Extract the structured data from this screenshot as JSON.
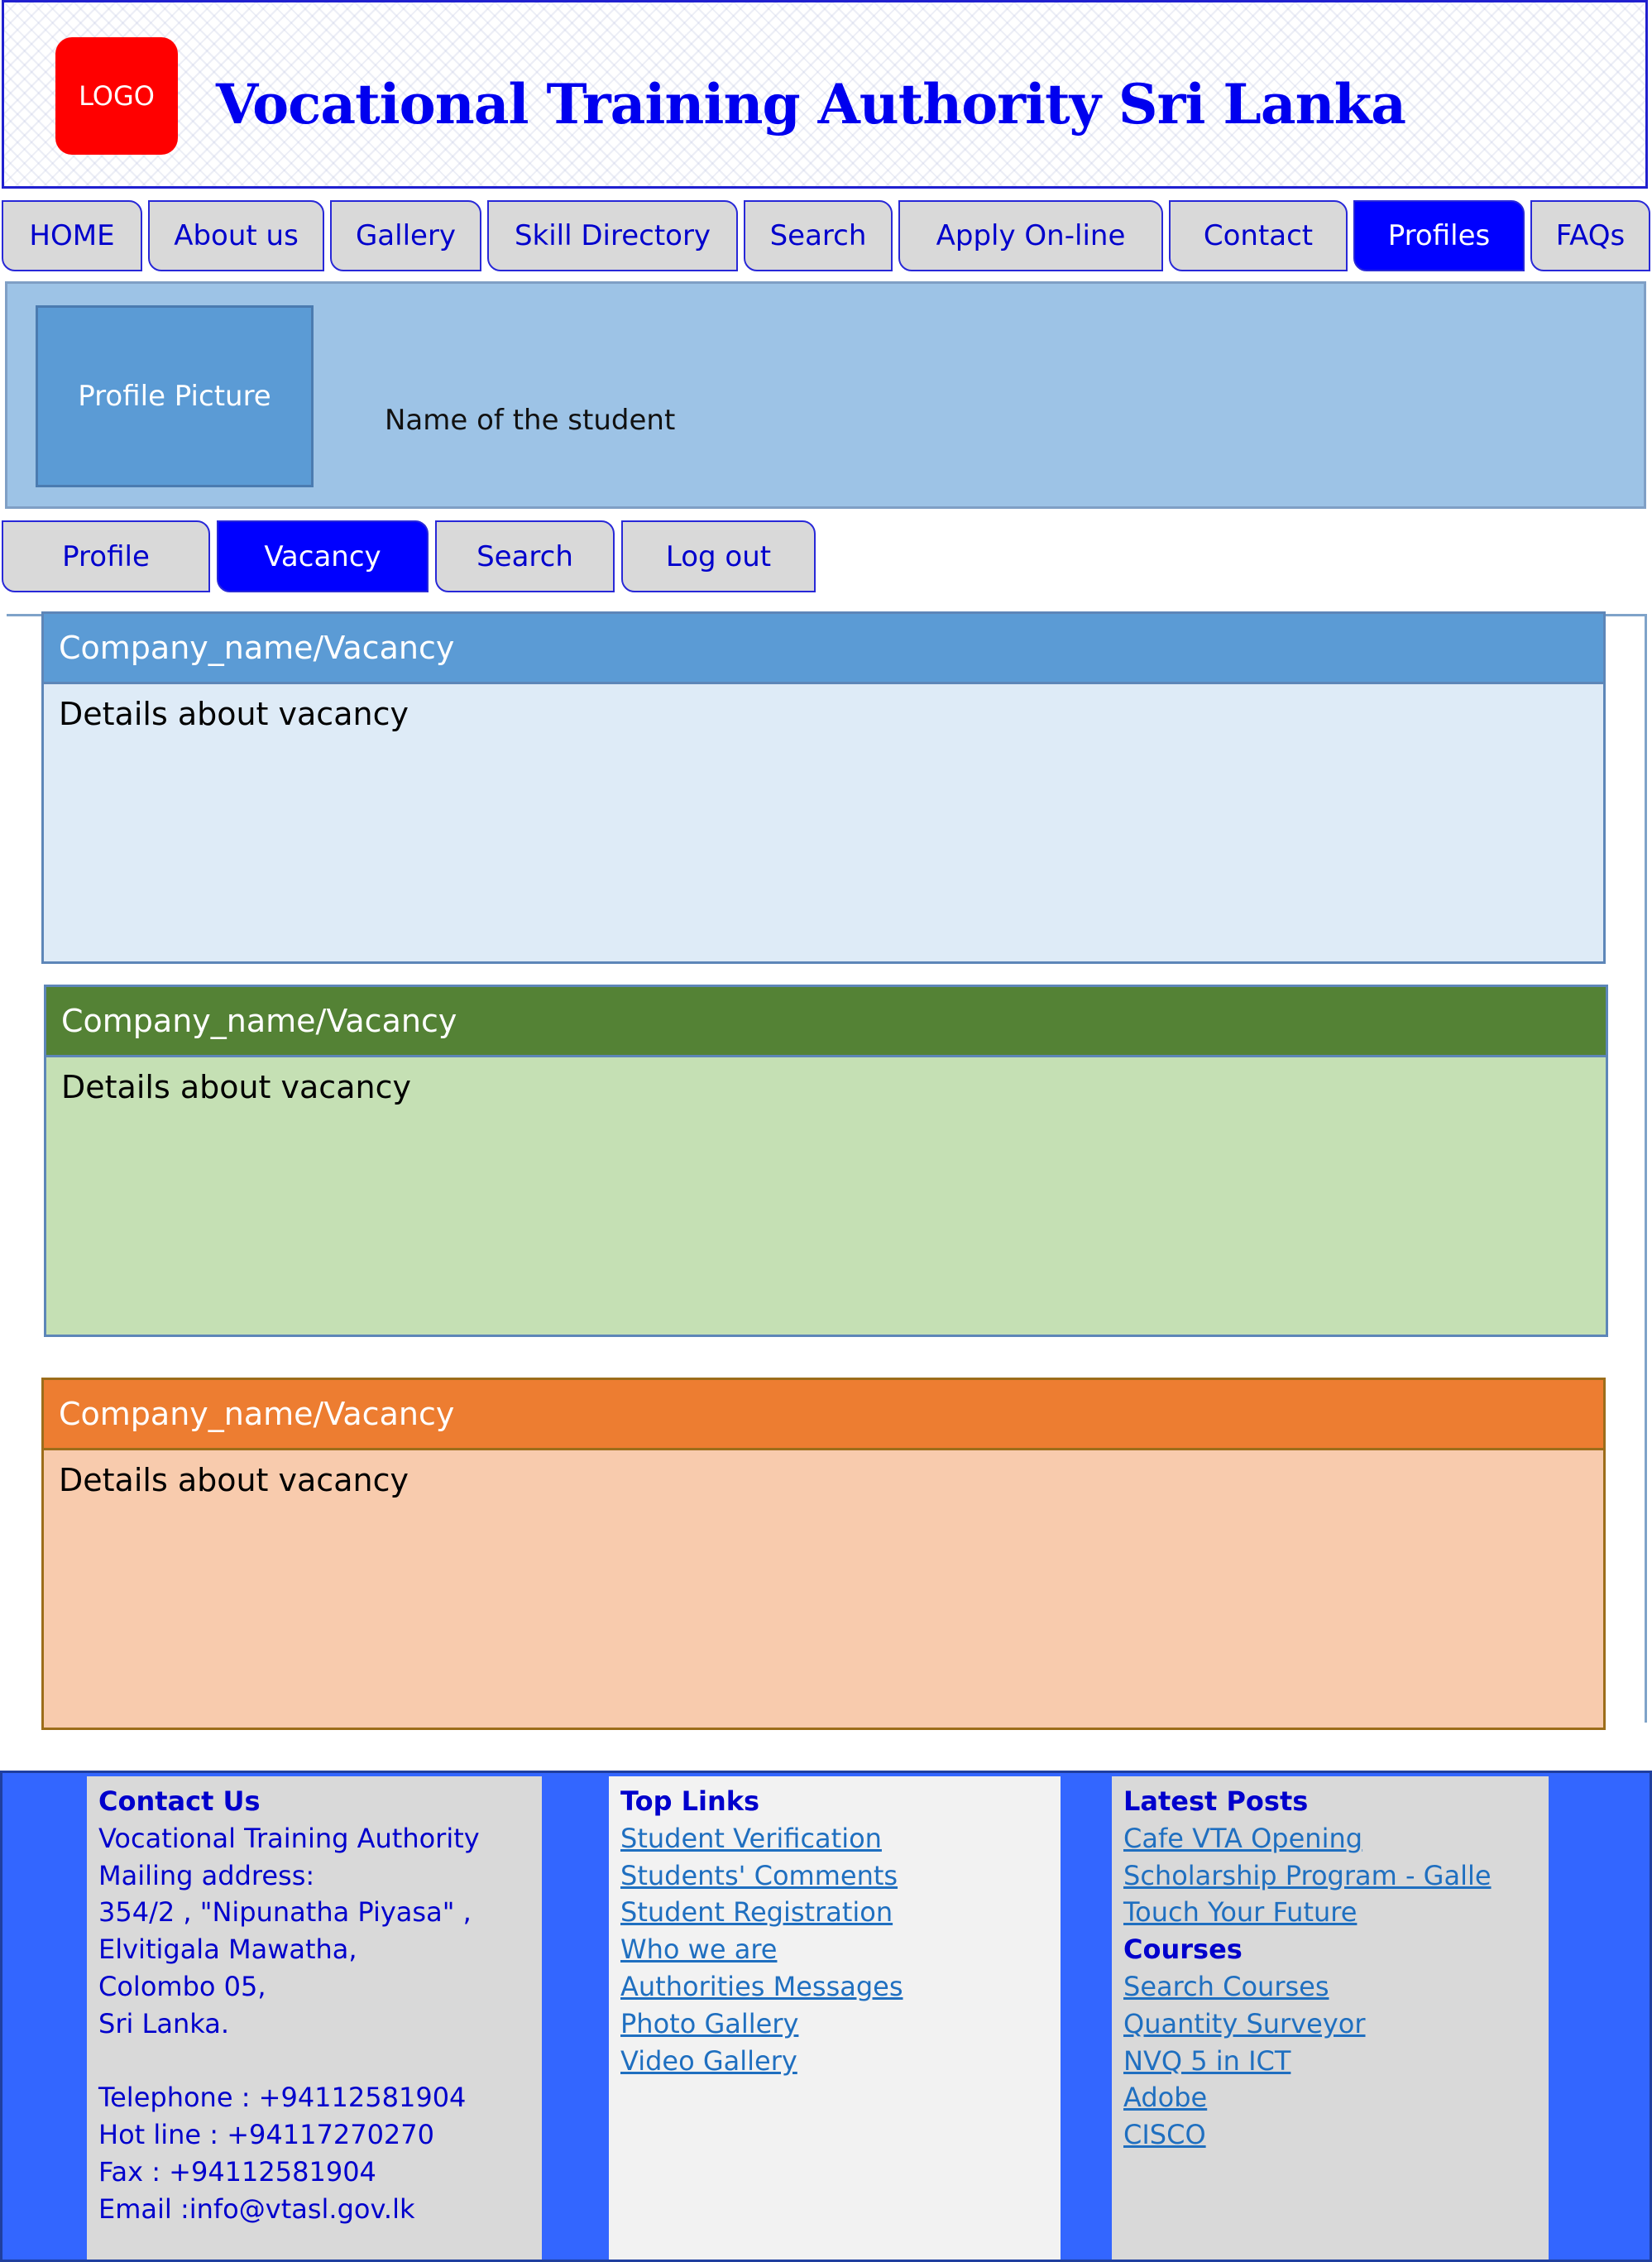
{
  "header": {
    "logo_text": "LOGO",
    "title": "Vocational Training Authority Sri Lanka"
  },
  "nav": {
    "tabs": [
      "HOME",
      "About us",
      "Gallery",
      "Skill Directory",
      "Search",
      "Apply On-line",
      "Contact",
      "Profiles",
      "FAQs"
    ],
    "active": "Profiles"
  },
  "profile": {
    "picture_label": "Profile Picture",
    "student_name": "Name of the student"
  },
  "subnav": {
    "tabs": [
      "Profile",
      "Vacancy",
      "Search",
      "Log out"
    ],
    "active": "Vacancy"
  },
  "vacancies": [
    {
      "title": "Company_name/Vacancy",
      "details": "Details about vacancy",
      "header_color": "#5b9bd5",
      "body_color": "#deebf7",
      "border_color": "#5d86b8"
    },
    {
      "title": "Company_name/Vacancy",
      "details": "Details about vacancy",
      "header_color": "#548235",
      "body_color": "#c5e0b4",
      "border_color": "#5d86b8"
    },
    {
      "title": "Company_name/Vacancy",
      "details": "Details about vacancy",
      "header_color": "#ed7d31",
      "body_color": "#f8cbad",
      "border_color": "#9c6d1a"
    }
  ],
  "footer": {
    "contact": {
      "heading": "Contact Us",
      "lines": [
        "Vocational Training Authority",
        "Mailing address:",
        "354/2 , \"Nipunatha Piyasa\" ,",
        "Elvitigala Mawatha,",
        "Colombo 05,",
        "Sri Lanka."
      ],
      "phones": [
        "Telephone : +94112581904",
        "Hot line : +94117270270",
        "Fax : +94112581904",
        "Email :info@vtasl.gov.lk"
      ]
    },
    "top_links": {
      "heading": "Top Links",
      "links": [
        "Student Verification",
        "Students' Comments",
        "Student Registration",
        "Who we are",
        "Authorities Messages",
        "Photo Gallery",
        "Video Gallery"
      ]
    },
    "latest_posts": {
      "heading": "Latest Posts",
      "links": [
        "Cafe VTA Opening",
        "Scholarship Program - Galle",
        "Touch Your Future"
      ]
    },
    "courses": {
      "heading": "Courses",
      "links": [
        "Search Courses",
        "Quantity Surveyor",
        "NVQ 5 in ICT",
        "Adobe",
        "CISCO"
      ]
    }
  },
  "colors": {
    "accent_blue": "#0000ff",
    "tab_gray": "#d9d9d9",
    "footer_blue": "#3366ff",
    "logo_red": "#ff0000"
  }
}
